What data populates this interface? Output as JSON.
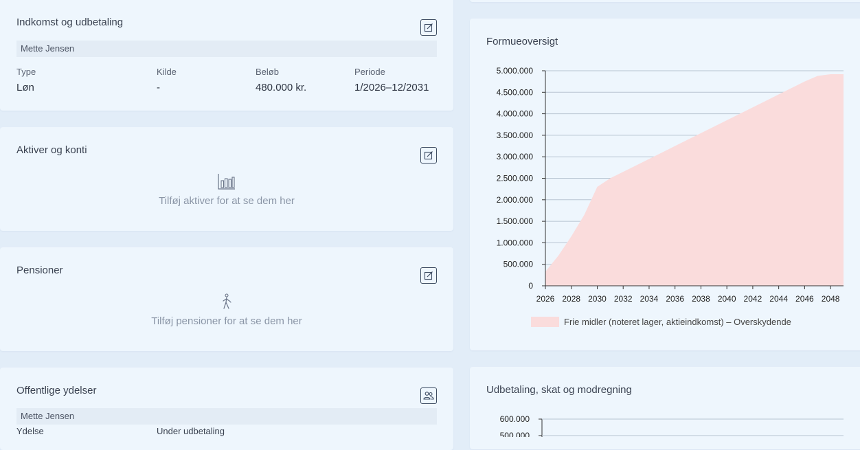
{
  "income_card": {
    "title": "Indkomst og udbetaling",
    "person": "Mette Jensen",
    "columns": [
      "Type",
      "Kilde",
      "Beløb",
      "Periode"
    ],
    "row": {
      "type": "Løn",
      "kilde": "-",
      "belob": "480.000 kr.",
      "periode": "1/2026–12/2031"
    }
  },
  "assets_card": {
    "title": "Aktiver og konti",
    "empty_text": "Tilføj aktiver for at se dem her",
    "icon": "bar-chart-icon"
  },
  "pensions_card": {
    "title": "Pensioner",
    "empty_text": "Tilføj pensioner for at se dem her",
    "icon": "walking-person-icon"
  },
  "benefits_card": {
    "title": "Offentlige ydelser",
    "person": "Mette Jensen",
    "columns": [
      "Ydelse",
      "Under udbetaling"
    ]
  },
  "wealth_chart_card": {
    "title": "Formueoversigt"
  },
  "payout_chart_card": {
    "title": "Udbetaling, skat og modregning"
  },
  "chart_data": [
    {
      "type": "area",
      "title": "Formueoversigt",
      "x": [
        2026,
        2027,
        2028,
        2029,
        2030,
        2031,
        2032,
        2033,
        2034,
        2035,
        2036,
        2037,
        2038,
        2039,
        2040,
        2041,
        2042,
        2043,
        2044,
        2045,
        2046,
        2047,
        2048,
        2049
      ],
      "x_ticks": [
        "2026",
        "2028",
        "2030",
        "2032",
        "2034",
        "2036",
        "2038",
        "2040",
        "2042",
        "2044",
        "2046",
        "2048"
      ],
      "y_ticks": [
        "0",
        "500.000",
        "1.000.000",
        "1.500.000",
        "2.000.000",
        "2.500.000",
        "3.000.000",
        "3.500.000",
        "4.000.000",
        "4.500.000",
        "5.000.000"
      ],
      "ylim": [
        0,
        5000000
      ],
      "xlim": [
        2026,
        2049
      ],
      "series": [
        {
          "name": "Frie midler (noteret lager, aktieindkomst) – Overskydende",
          "color": "#fadcdc",
          "values": [
            330000,
            700000,
            1150000,
            1650000,
            2300000,
            2500000,
            2650000,
            2800000,
            2950000,
            3100000,
            3250000,
            3400000,
            3550000,
            3700000,
            3850000,
            4000000,
            4150000,
            4300000,
            4450000,
            4600000,
            4750000,
            4880000,
            4920000,
            4920000
          ]
        }
      ],
      "legend": "bottom"
    },
    {
      "type": "bar",
      "title": "Udbetaling, skat og modregning",
      "y_ticks": [
        "600.000",
        "500.000"
      ],
      "ylim": [
        0,
        600000
      ]
    }
  ]
}
